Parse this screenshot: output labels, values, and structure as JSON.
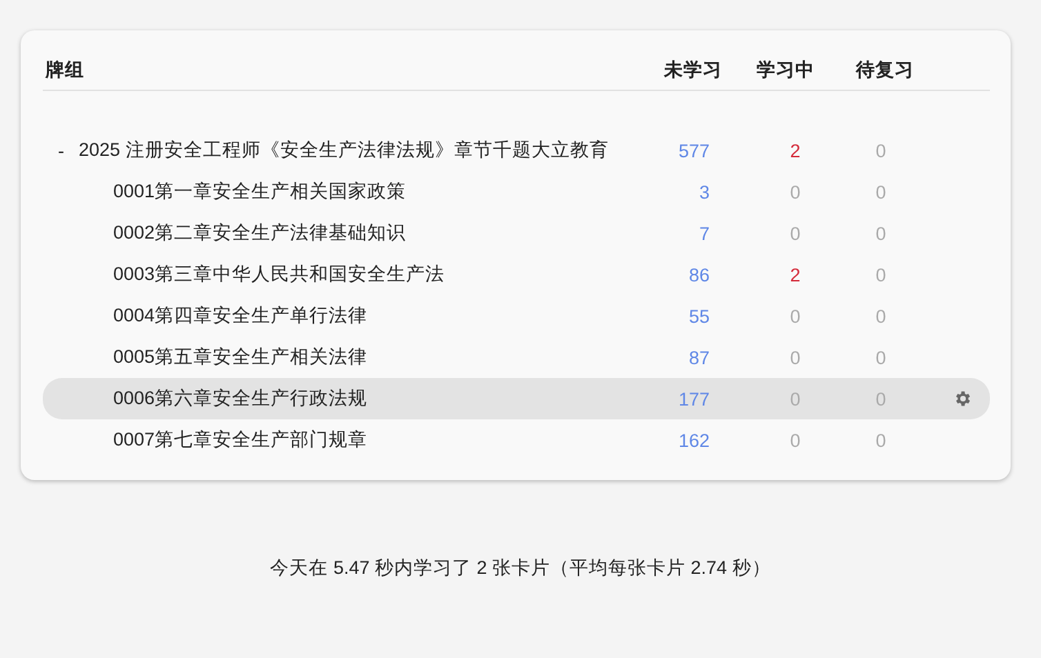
{
  "table": {
    "columns": [
      "牌组",
      "未学习",
      "学习中",
      "待复习"
    ],
    "rows": [
      {
        "name": "2025 注册安全工程师《安全生产法律法规》章节千题大立教育",
        "toggle": "-",
        "expanded": true,
        "selected": false,
        "new": "577",
        "learning": "2",
        "review": "0",
        "children": [
          {
            "name": "0001第一章安全生产相关国家政策",
            "selected": false,
            "new": "3",
            "learning": "0",
            "review": "0"
          },
          {
            "name": "0002第二章安全生产法律基础知识",
            "selected": false,
            "new": "7",
            "learning": "0",
            "review": "0"
          },
          {
            "name": "0003第三章中华人民共和国安全生产法",
            "selected": false,
            "new": "86",
            "learning": "2",
            "review": "0"
          },
          {
            "name": "0004第四章安全生产单行法律",
            "selected": false,
            "new": "55",
            "learning": "0",
            "review": "0"
          },
          {
            "name": "0005第五章安全生产相关法律",
            "selected": false,
            "new": "87",
            "learning": "0",
            "review": "0"
          },
          {
            "name": "0006第六章安全生产行政法规",
            "selected": true,
            "new": "177",
            "learning": "0",
            "review": "0"
          },
          {
            "name": "0007第七章安全生产部门规章",
            "selected": false,
            "new": "162",
            "learning": "0",
            "review": "0"
          }
        ]
      }
    ]
  },
  "footer": "今天在 5.47 秒内学习了 2 张卡片（平均每张卡片 2.74 秒）"
}
